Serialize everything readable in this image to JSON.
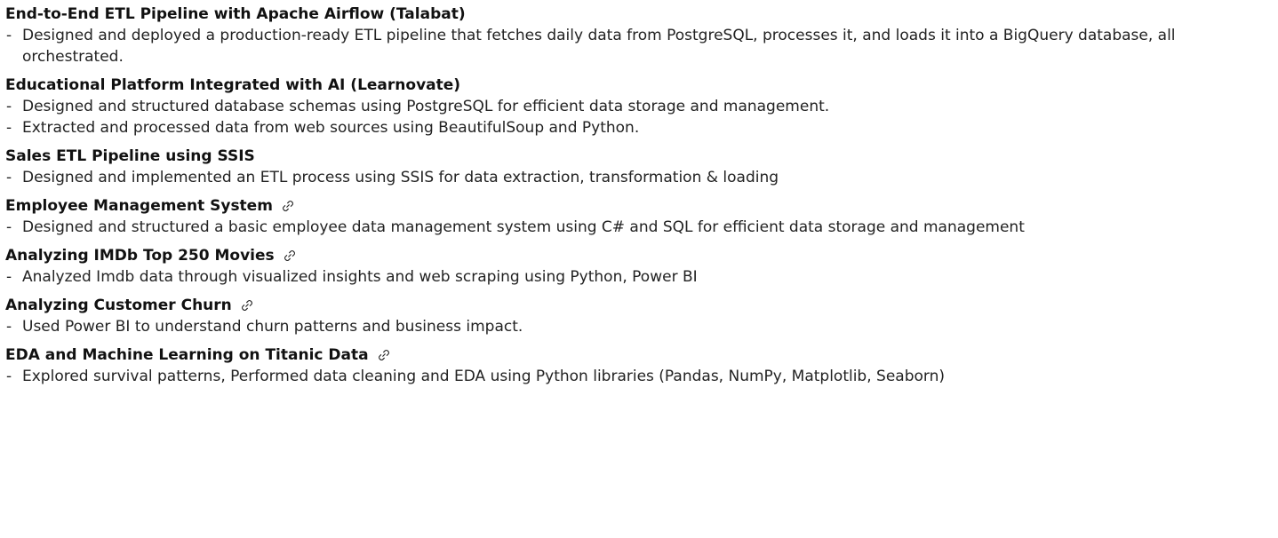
{
  "projects": [
    {
      "title": "End-to-End ETL Pipeline with Apache Airflow (Talabat)",
      "has_link": false,
      "bullets": [
        "Designed and deployed a production-ready ETL pipeline that fetches daily data from PostgreSQL, processes it, and loads it into a BigQuery database, all orchestrated."
      ]
    },
    {
      "title": "Educational Platform Integrated with AI (Learnovate)",
      "has_link": false,
      "bullets": [
        "Designed and structured database schemas using PostgreSQL for efficient data storage and management.",
        "Extracted and processed data from web sources using BeautifulSoup and Python."
      ]
    },
    {
      "title": "Sales ETL Pipeline using SSIS",
      "has_link": false,
      "bullets": [
        "Designed and implemented an ETL process using SSIS for data extraction, transformation & loading"
      ]
    },
    {
      "title": "Employee Management System",
      "has_link": true,
      "link_icon": "link-icon",
      "bullets": [
        "Designed and structured a basic employee data management system using C# and SQL for efficient data storage and management"
      ]
    },
    {
      "title": "Analyzing IMDb Top 250 Movies",
      "has_link": true,
      "link_icon": "link-icon",
      "bullets": [
        "Analyzed Imdb data through visualized insights and web scraping using Python, Power BI"
      ]
    },
    {
      "title": "Analyzing Customer Churn",
      "has_link": true,
      "link_icon": "link-icon",
      "bullets": [
        "Used Power BI to understand churn patterns and business impact."
      ]
    },
    {
      "title": "EDA and Machine Learning on Titanic Data",
      "has_link": true,
      "link_icon": "link-icon",
      "bullets": [
        "Explored survival patterns, Performed data cleaning and EDA using Python libraries (Pandas, NumPy, Matplotlib, Seaborn)"
      ]
    }
  ],
  "bullet_marker": "-",
  "colors": {
    "text": "#222222",
    "title": "#111111"
  }
}
